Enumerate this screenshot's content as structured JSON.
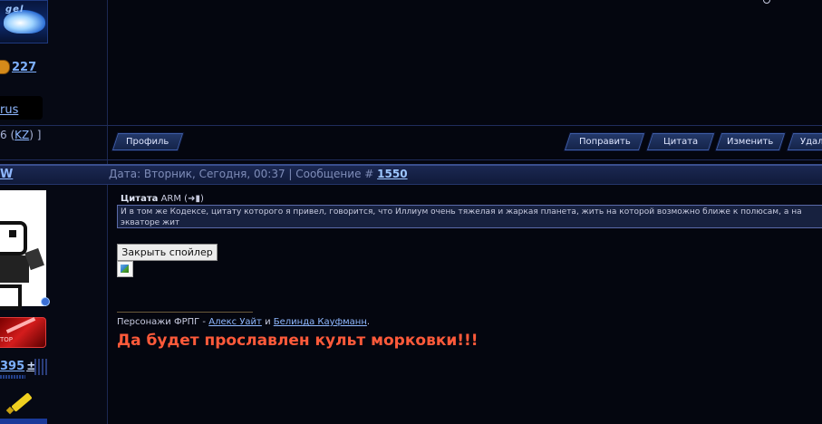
{
  "upper_post": {
    "rank_word": "gel",
    "count": "227",
    "lang": "rus",
    "kz_prefix": "6 (",
    "kz_link": "KZ",
    "kz_suffix": ") ]"
  },
  "actions": {
    "profile": "Профиль",
    "edit": "Поправить",
    "quote": "Цитата",
    "change": "Изменить",
    "delete": "Удал"
  },
  "post": {
    "nick_fragment": "W",
    "date_text": "Дата: Вторник, Сегодня, 00:37 | Сообщение #",
    "message_number": "1550",
    "quote_label": "Цитата",
    "quote_author": "ARM",
    "quote_open": "(",
    "quote_close": ")",
    "quote_text": "И в том же Кодексе, цитату которого я привел, говорится, что Иллиум очень тяжелая и жаркая планета, жить на которой возможно ближе к полюсам, а на экваторе жит\nв особых зданиях, чтобы не поджариться. Как-то слабо похоже на сад.",
    "spoiler_button": "Закрыть спойлер",
    "award_small": "TOP",
    "rep_value": "395",
    "rep_sign": "±"
  },
  "signature": {
    "prefix": "Персонажи ФРПГ -",
    "char1": "Алекс Уайт",
    "and": "и",
    "char2": "Белинда Кауфманн",
    "dot": ".",
    "slogan": "Да будет прославлен культ морковки!!!"
  },
  "colors": {
    "background": "#04060f",
    "link": "#8fb8ff",
    "slogan": "#ff5a3a",
    "quote_bg": "#17213f"
  },
  "icons": {
    "rank": "winged-rank-icon",
    "coin": "coin-icon",
    "arrow": "arrow-right-icon",
    "page": "page-icon",
    "gear": "gear-icon",
    "award": "award-icon",
    "pen": "pen-icon",
    "broken_image": "broken-image-icon",
    "search": "search-icon"
  }
}
